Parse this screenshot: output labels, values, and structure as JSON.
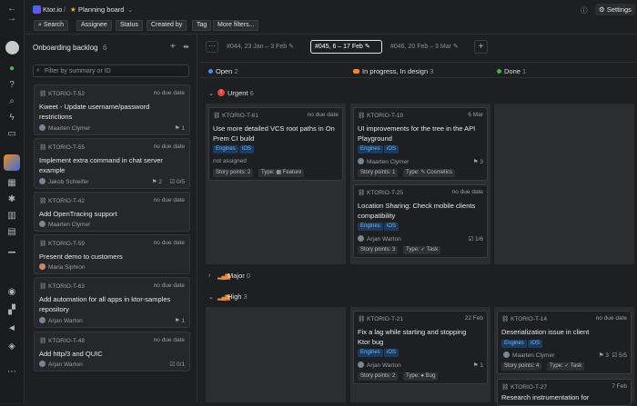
{
  "rail": {
    "icons": [
      "back-icon",
      "forward-icon",
      "avatar",
      "status-icon",
      "question-icon",
      "search-icon",
      "lightning-icon",
      "project-icon",
      "grid-icon",
      "star-icon",
      "board-icon",
      "document-icon",
      "bar-icon",
      "chat-icon",
      "apps-icon",
      "megaphone-icon",
      "more-icon"
    ]
  },
  "header": {
    "project": "Ktor.io",
    "separator": "/",
    "board": "Planning board",
    "settings_label": "Settings",
    "filters": [
      "Search",
      "Assignee",
      "Status",
      "Created by",
      "Tag",
      "More filters..."
    ]
  },
  "backlog": {
    "title": "Onboarding backlog",
    "count": "6",
    "filter_placeholder": "Filter by summary or ID",
    "items": [
      {
        "id": "KTORIO-T-52",
        "due": "no due date",
        "title1": "Kweet - Update username/password",
        "title2": "restrictions",
        "assignee": "Maarten Clymer",
        "meta": "1"
      },
      {
        "id": "KTORIO-T-55",
        "due": "no due date",
        "title1": "Implement extra command in chat server",
        "title2": "example",
        "assignee": "Jakob Schleifer",
        "meta": "2",
        "meta2": "0/5"
      },
      {
        "id": "KTORIO-T-42",
        "due": "no due date",
        "title1": "Add OpenTracing support",
        "title2": "",
        "assignee": "Maarten Clymer",
        "meta": ""
      },
      {
        "id": "KTORIO-T-59",
        "due": "no due date",
        "title1": "Present demo to customers",
        "title2": "",
        "assignee": "Maria Siphron",
        "meta": ""
      },
      {
        "id": "KTORIO-T-63",
        "due": "no due date",
        "title1": "Add automation for all apps in ktor-samples",
        "title2": "repository",
        "assignee": "Arjan Warton",
        "meta": "1"
      },
      {
        "id": "KTORIO-T-48",
        "due": "no due date",
        "title1": "Add http/3 and QUIC",
        "title2": "",
        "assignee": "Arjan Warton",
        "meta2": "0/1"
      }
    ]
  },
  "sprints": {
    "menu": "···",
    "items": [
      "#044, 23 Jan – 3 Feb",
      "#045, 6 – 17 Feb",
      "#046, 20 Feb – 3 Mar"
    ],
    "add": "+"
  },
  "columns": [
    {
      "name": "Open",
      "count": "2",
      "color": "#4a8fe7"
    },
    {
      "name": "In progress, In design",
      "count": "3",
      "color": "#e8893a"
    },
    {
      "name": "Done",
      "count": "1",
      "color": "#4caf50"
    }
  ],
  "swimlanes": {
    "urgent": {
      "label": "Urgent",
      "count": "6"
    },
    "major": {
      "label": "Major",
      "count": "0"
    },
    "high": {
      "label": "High",
      "count": "3"
    }
  },
  "cards": {
    "t61": {
      "id": "KTORIO-T-61",
      "due": "no due date",
      "title1": "Use more detailed VCS root paths in On",
      "title2": "Prem CI build",
      "tags": [
        "Engines",
        "iOS"
      ],
      "assignee": "not assigned",
      "points": "Story points: 2",
      "type": "Type: ▦ Feature"
    },
    "t19": {
      "id": "KTORIO-T-19",
      "due": "6 Mar",
      "title1": "UI improvements for the tree in the API",
      "title2": "Playground",
      "tags": [
        "Engines",
        "iOS"
      ],
      "assignee": "Maarten Clymer",
      "count": "3",
      "points": "Story points: 1",
      "type": "Type: ✎ Cosmetics"
    },
    "t25": {
      "id": "KTORIO-T-25",
      "due": "no due date",
      "title1": "Location Sharing: Check mobile clients",
      "title2": "compatibility",
      "tags": [
        "Engines",
        "iOS"
      ],
      "assignee": "Arjan Warton",
      "count": "1/6",
      "points": "Story points: 3",
      "type": "Type: ✓ Task"
    },
    "t21": {
      "id": "KTORIO-T-21",
      "due": "22 Feb",
      "title1": "Fix a lag while starting and stopping",
      "title2": "Ktor bug",
      "tags": [
        "Engines",
        "iOS"
      ],
      "assignee": "Arjan Warton",
      "count": "1",
      "points": "Story points: 2",
      "type": "Type: ● Bug"
    },
    "t14": {
      "id": "KTORIO-T-14",
      "due": "no due date",
      "title1": "Deserialization issue in client",
      "tags": [
        "Engines",
        "iOS"
      ],
      "assignee": "Maarten Clymer",
      "count": "3",
      "count2": "5/5",
      "points": "Story points: 4",
      "type": "Type: ✓ Task"
    },
    "t27": {
      "id": "KTORIO-T-27",
      "due": "7 Feb",
      "title1": "Research instrumentation for"
    }
  }
}
